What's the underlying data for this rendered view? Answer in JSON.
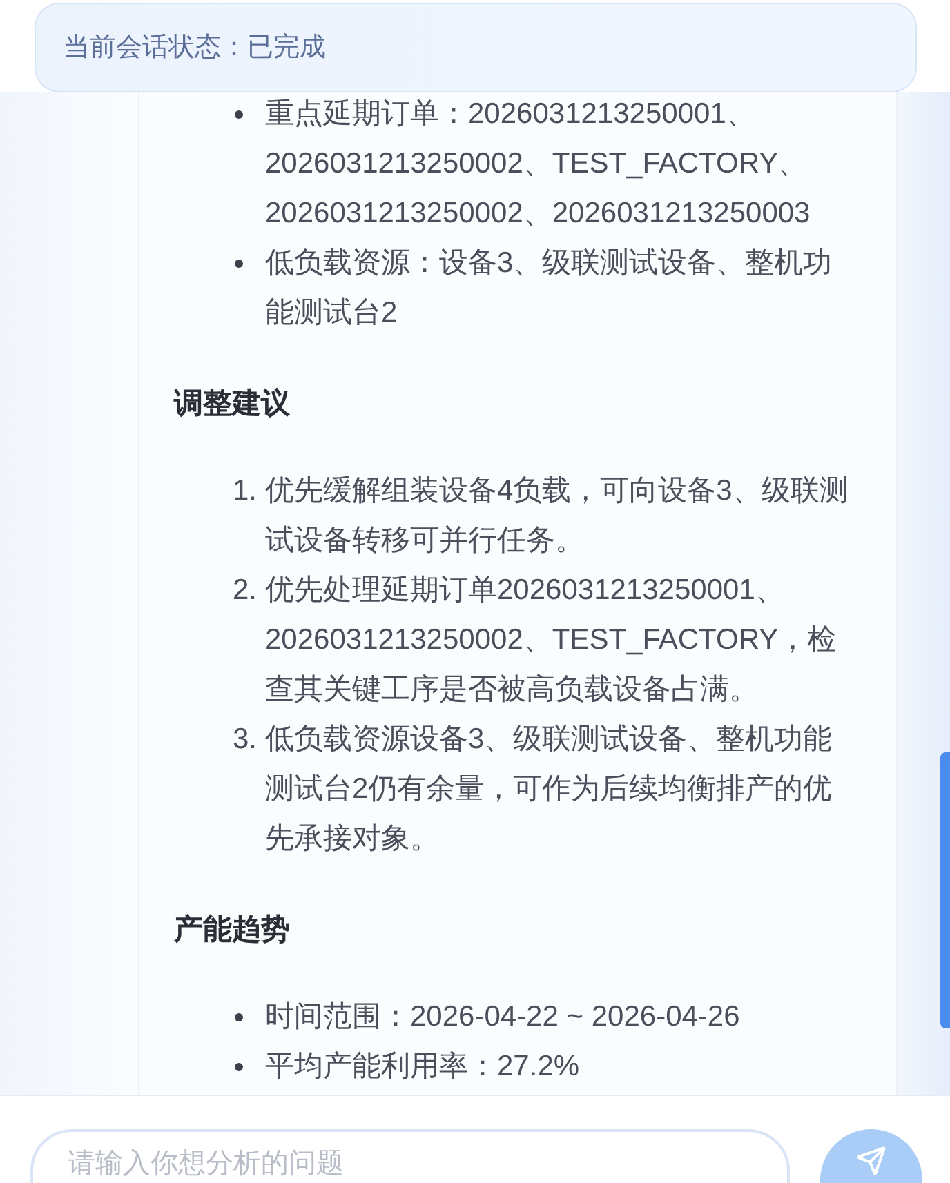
{
  "status_banner": {
    "text": "当前会话状态：已完成"
  },
  "message": {
    "sections": [
      {
        "kind": "bullets",
        "items": [
          {
            "text": "重点延期订单：2026031213250001、2026031213250002、TEST_FACTORY、2026031213250002、2026031213250003"
          },
          {
            "text": "低负载资源：设备3、级联测试设备、整机功能测试台2"
          }
        ]
      },
      {
        "kind": "heading",
        "text": "调整建议"
      },
      {
        "kind": "numbered",
        "items": [
          {
            "number": "1.",
            "text": "优先缓解组装设备4负载，可向设备3、级联测试设备转移可并行任务。"
          },
          {
            "number": "2.",
            "text": "优先处理延期订单2026031213250001、2026031213250002、TEST_FACTORY，检查其关键工序是否被高负载设备占满。"
          },
          {
            "number": "3.",
            "text": "低负载资源设备3、级联测试设备、整机功能测试台2仍有余量，可作为后续均衡排产的优先承接对象。"
          }
        ]
      },
      {
        "kind": "heading",
        "text": "产能趋势"
      },
      {
        "kind": "bullets",
        "items": [
          {
            "text": "时间范围：2026-04-22 ~ 2026-04-26"
          },
          {
            "text": "平均产能利用率：27.2%"
          }
        ]
      }
    ]
  },
  "input": {
    "placeholder": "请输入你想分析的问题"
  }
}
